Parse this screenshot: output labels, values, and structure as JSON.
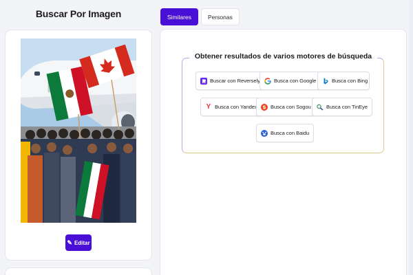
{
  "left": {
    "title": "Buscar Por Imagen",
    "edit_button": "Editar"
  },
  "tabs": [
    {
      "label": "Similares",
      "active": true
    },
    {
      "label": "Personas",
      "active": false
    }
  ],
  "engines": {
    "title": "Obtener resultados de varios motores de búsqueda",
    "items": [
      {
        "label": "Buscar con Reversely",
        "icon": "reversely-icon"
      },
      {
        "label": "Busca con Google",
        "icon": "google-icon"
      },
      {
        "label": "Busca con Bing",
        "icon": "bing-icon"
      },
      {
        "label": "Busca con Yandex",
        "icon": "yandex-icon"
      },
      {
        "label": "Busca con Sogou",
        "icon": "sogou-icon"
      },
      {
        "label": "Busca con TinEye",
        "icon": "tineye-icon"
      },
      {
        "label": "Busca con Baidu",
        "icon": "baidu-icon"
      }
    ]
  },
  "colors": {
    "accent": "#4a0fd6",
    "background": "#f3f4f8"
  }
}
